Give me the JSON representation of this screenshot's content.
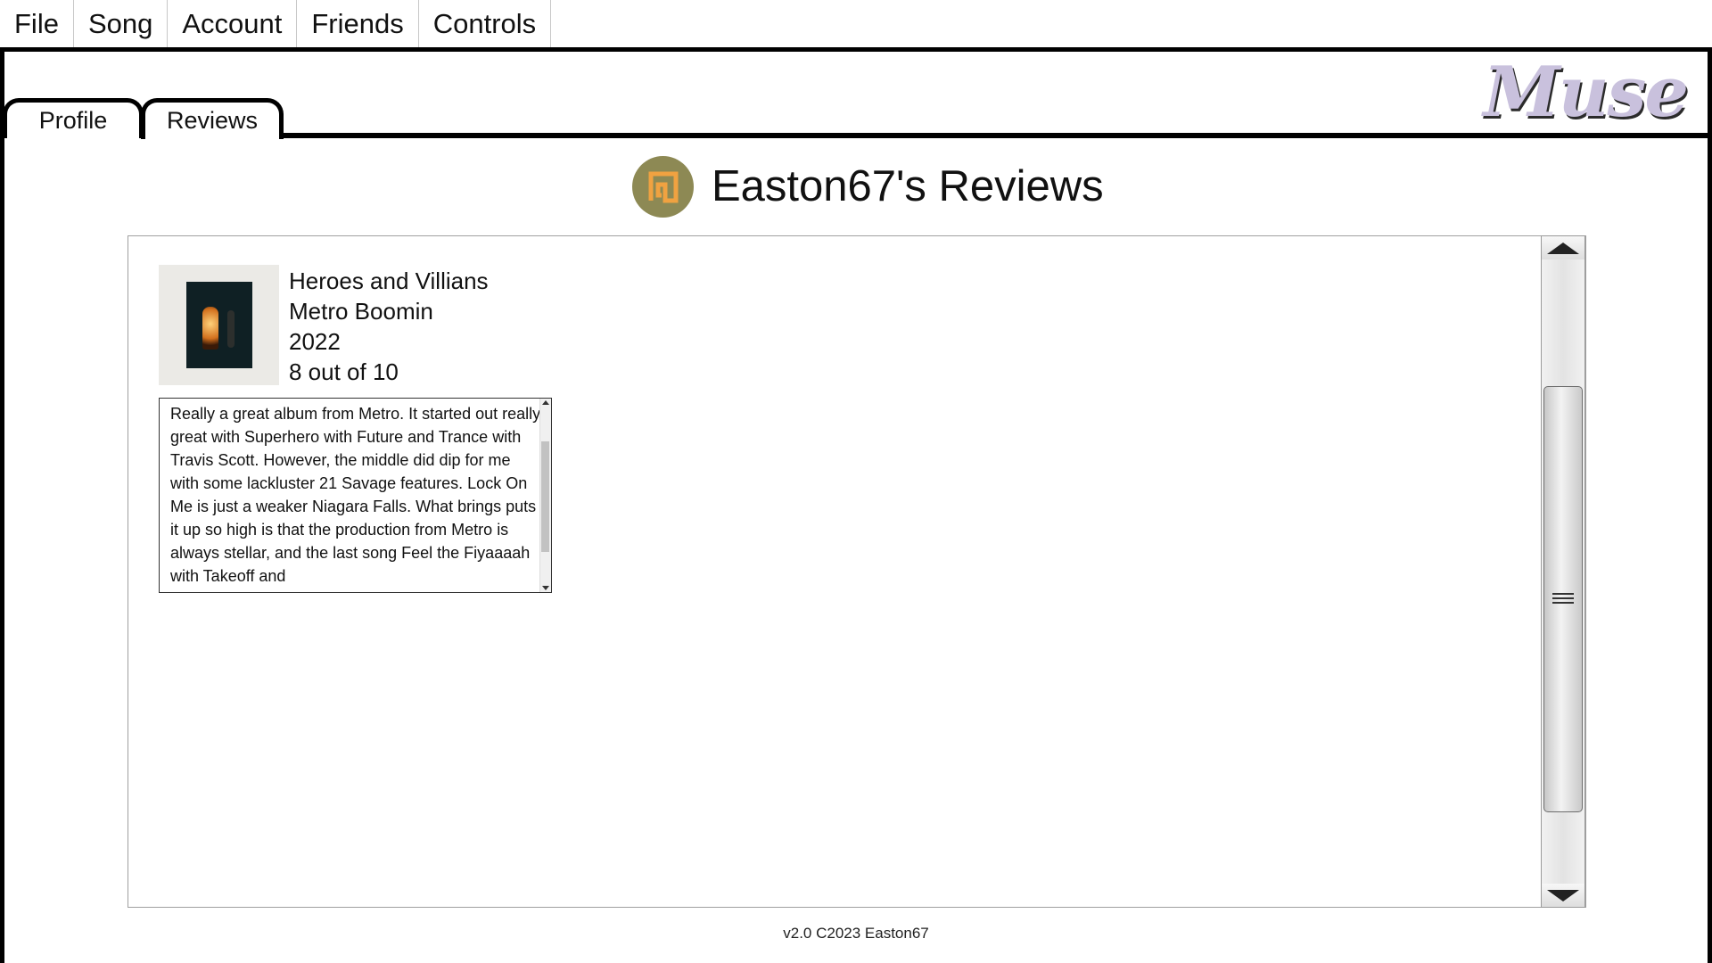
{
  "menu": [
    "File",
    "Song",
    "Account",
    "Friends",
    "Controls"
  ],
  "tabs": {
    "profile": "Profile",
    "reviews": "Reviews",
    "active": "Reviews"
  },
  "logo": {
    "text": "Muse"
  },
  "title": "Easton67's Reviews",
  "avatar": {
    "color": "#8d8954",
    "glyph_color": "#f0a241"
  },
  "review": {
    "album": "Heroes and Villians",
    "artist": "Metro Boomin",
    "year": "2022",
    "rating": "8 out of 10",
    "text": "Really a great album from Metro. It started out really great with Superhero with Future and Trance with Travis Scott. However, the middle did dip for me with some lackluster 21 Savage features. Lock On Me is just a weaker Niagara Falls. What brings puts it up so high is that the production from Metro is always stellar, and the last song Feel the Fiyaaaah with Takeoff and"
  },
  "footer": "v2.0 C2023 Easton67"
}
